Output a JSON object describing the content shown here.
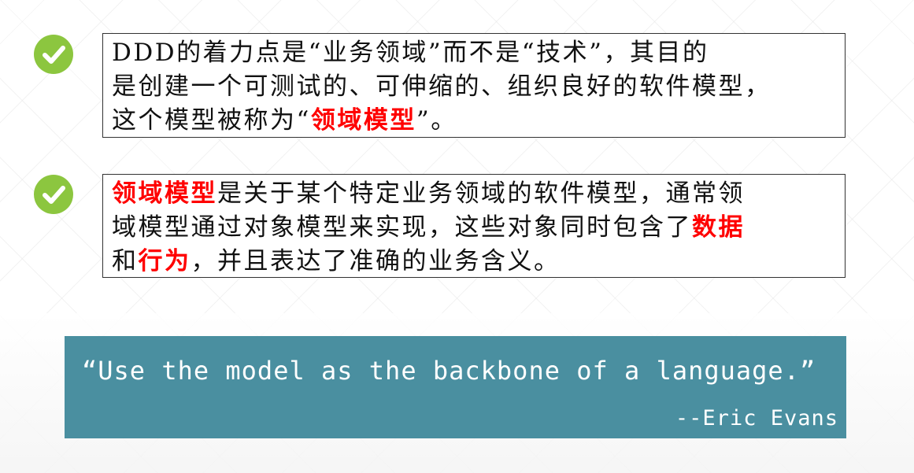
{
  "point_1": {
    "icon": "check-circle-icon",
    "icon_color": "#8cc63f",
    "line_1": "DDD的着力点是“业务领域”而不是“技术”，其目的",
    "line_2": "是创建一个可测试的、可伸缩的、组织良好的软件模型，",
    "line_3_before": "这个模型被称为“",
    "line_3_highlight": "领域模型",
    "line_3_after": "”。"
  },
  "point_2": {
    "icon": "check-circle-icon",
    "icon_color": "#8cc63f",
    "line_1_highlight": "领域模型",
    "line_1_after": "是关于某个特定业务领域的软件模型，通常领",
    "line_2_before": "域模型通过对象模型来实现，这些对象同时包含了",
    "line_2_highlight": "数据",
    "line_3_before": "和",
    "line_3_highlight": "行为",
    "line_3_after": "，并且表达了准确的业务含义。"
  },
  "quote": {
    "text": "“Use the model as the backbone of a language.”",
    "author": "--Eric Evans",
    "background_color": "#4a8fa0"
  },
  "colors": {
    "highlight": "#ff0000",
    "text": "#111111"
  }
}
